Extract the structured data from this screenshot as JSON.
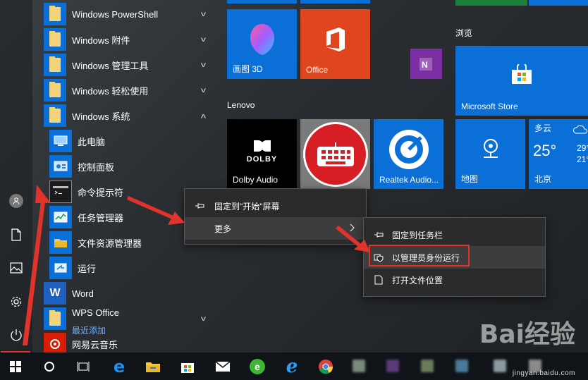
{
  "colors": {
    "accent": "#0a6fd6",
    "office": "#e0461e",
    "onenote": "#7b2fa3",
    "highlight": "#e0342b",
    "link": "#6fb1ff"
  },
  "app_list": {
    "items": [
      {
        "label": "Windows PowerShell",
        "icon": "folder-icon",
        "expand": true
      },
      {
        "label": "Windows 附件",
        "icon": "folder-icon",
        "expand": true
      },
      {
        "label": "Windows 管理工具",
        "icon": "folder-icon",
        "expand": true
      },
      {
        "label": "Windows 轻松使用",
        "icon": "folder-icon",
        "expand": true
      },
      {
        "label": "Windows 系统",
        "icon": "folder-icon",
        "expanded": true
      },
      {
        "label": "此电脑",
        "icon": "computer-icon"
      },
      {
        "label": "控制面板",
        "icon": "control-panel-icon"
      },
      {
        "label": "命令提示符",
        "icon": "command-prompt-icon"
      },
      {
        "label": "任务管理器",
        "icon": "task-manager-icon"
      },
      {
        "label": "文件资源管理器",
        "icon": "file-explorer-icon"
      },
      {
        "label": "运行",
        "icon": "run-icon"
      },
      {
        "label": "Word",
        "icon": "word-icon"
      },
      {
        "label": "WPS Office",
        "icon": "folder-icon",
        "expand": true
      },
      {
        "label": "网易云音乐",
        "icon": "netease-music-icon"
      }
    ],
    "recent_label": "最近添加"
  },
  "tiles": {
    "paint3d": "画图 3D",
    "office": "Office",
    "group_lenovo": "Lenovo",
    "dolby": "Dolby Audio",
    "realtek": "Realtek Audio...",
    "group_browse": "浏览",
    "store": "Microsoft Store",
    "maps": "地图",
    "weather": {
      "condition": "多云",
      "temp": "25°",
      "high": "29°",
      "low": "21°",
      "city": "北京"
    },
    "dolby_logo": "DOLBY"
  },
  "context_menu": {
    "pin_start": "固定到\"开始\"屏幕",
    "more": "更多"
  },
  "submenu": {
    "pin_taskbar": "固定到任务栏",
    "run_admin": "以管理员身份运行",
    "open_location": "打开文件位置"
  },
  "watermark": {
    "brand": "Bai经验",
    "url": "jingyan.baidu.com"
  }
}
